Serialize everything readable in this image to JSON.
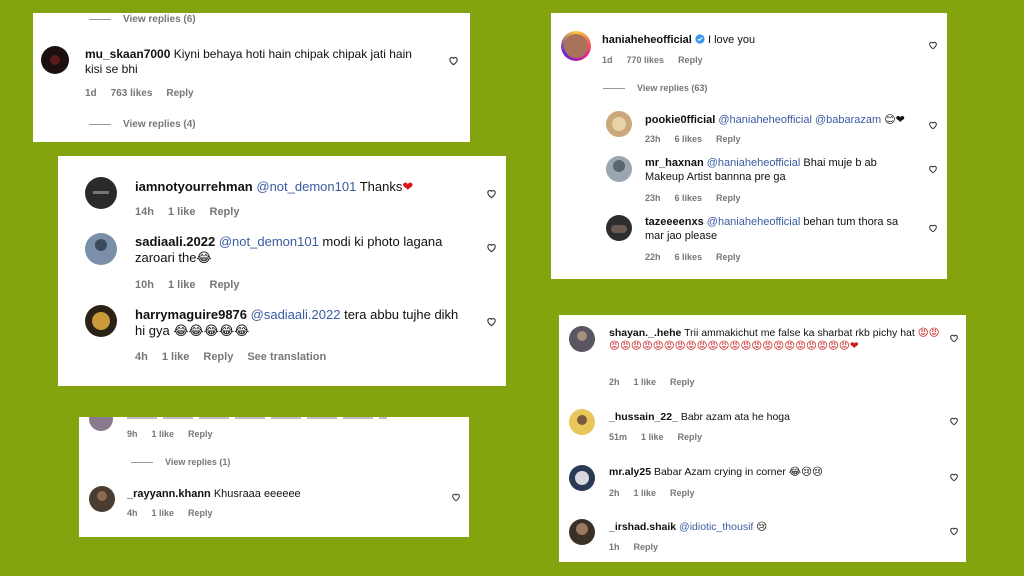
{
  "background_color": "#83a30f",
  "mention_color": "#3a5ba0",
  "card1": {
    "view_replies_top": "View replies (6)",
    "comment": {
      "username": "mu_skaan7000",
      "text": "Kiyni behaya hoti hain chipak chipak jati hain kisi se bhi",
      "time": "1d",
      "likes": "763 likes",
      "reply": "Reply"
    },
    "view_replies_bottom": "View replies (4)"
  },
  "card2": {
    "comments": [
      {
        "username": "iamnotyourrehman",
        "mention": "@not_demon101",
        "text": "Thanks",
        "emoji": "❤",
        "time": "14h",
        "likes": "1 like",
        "reply": "Reply"
      },
      {
        "username": "sadiaali.2022",
        "mention": "@not_demon101",
        "text": "modi ki photo lagana zaroari the",
        "emoji": "😂",
        "time": "10h",
        "likes": "1 like",
        "reply": "Reply"
      },
      {
        "username": "harrymaguire9876",
        "mention": "@sadiaali.2022",
        "text": "tera abbu tujhe dikh hi gya",
        "emoji": "😂😂😂😂😂",
        "time": "4h",
        "likes": "1 like",
        "reply": "Reply",
        "translate": "See translation"
      }
    ]
  },
  "card3": {
    "partial": {
      "time": "9h",
      "likes": "1 like",
      "reply": "Reply"
    },
    "view_replies": "View replies (1)",
    "comment": {
      "username": "_rayyann.khann",
      "text": "Khusraaa eeeeee",
      "time": "4h",
      "likes": "1 like",
      "reply": "Reply"
    }
  },
  "card4": {
    "main": {
      "username": "haniaheheofficial",
      "text": "I love you",
      "time": "1d",
      "likes": "770 likes",
      "reply": "Reply"
    },
    "verified_icon": "verified-badge-icon",
    "view_replies": "View replies (63)",
    "replies": [
      {
        "username": "pookie0fficial",
        "mention": "@haniaheheofficial @babarazam",
        "emoji": "😊❤",
        "time": "23h",
        "likes": "6 likes",
        "reply": "Reply"
      },
      {
        "username": "mr_haxnan",
        "mention": "@haniaheheofficial",
        "text": "Bhai muje b ab Makeup Artist bannna pre ga",
        "time": "23h",
        "likes": "6 likes",
        "reply": "Reply"
      },
      {
        "username": "tazeeeenxs",
        "mention": "@haniaheheofficial",
        "text": "behan tum thora sa mar jao please",
        "time": "22h",
        "likes": "6 likes",
        "reply": "Reply"
      }
    ]
  },
  "card5": {
    "comments": [
      {
        "username": "shayan._.hehe",
        "text": "Trii ammakichut me false ka sharbat rkb pichy hat",
        "emoji": "😡😡😡😡😡😡😡😡😡😡😡😡😡😡😡😡😡😡😡😡😡😡😡😡❤",
        "time": "2h",
        "likes": "1 like",
        "reply": "Reply"
      },
      {
        "username": "_hussain_22_",
        "text": "Babr azam ata he hoga",
        "time": "51m",
        "likes": "1 like",
        "reply": "Reply"
      },
      {
        "username": "mr.aly25",
        "text": "Babar Azam crying in corner",
        "emoji": "😂😢😢",
        "time": "2h",
        "likes": "1 like",
        "reply": "Reply"
      },
      {
        "username": "_irshad.shaik",
        "mention": "@idiotic_thousif",
        "emoji": "😢",
        "time": "1h",
        "reply": "Reply"
      }
    ]
  }
}
